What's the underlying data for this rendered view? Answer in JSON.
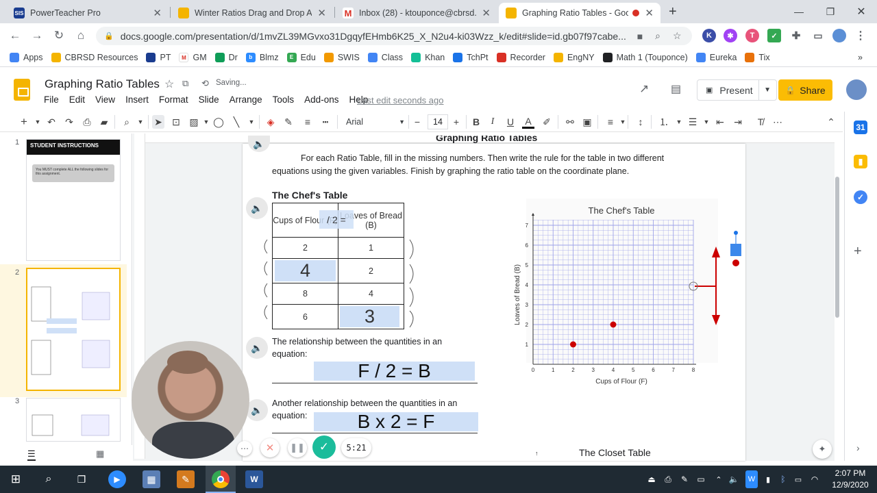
{
  "tabs": [
    {
      "title": "PowerTeacher Pro",
      "icon": "sis-icon"
    },
    {
      "title": "Winter Ratios Drag and Drop Act",
      "icon": "slides-icon"
    },
    {
      "title": "Inbox (28) - ktouponce@cbrsd.o",
      "icon": "gmail-icon"
    },
    {
      "title": "Graphing Ratio Tables - Goo",
      "icon": "slides-icon",
      "active": true
    }
  ],
  "url": "docs.google.com/presentation/d/1mvZL39MGvxo31DgqyfEHmb6K25_X_N2u4-ki03Wzz_k/edit#slide=id.gb07f97cabe...",
  "bookmarks": [
    "Apps",
    "CBRSD Resources",
    "PT",
    "GM",
    "Dr",
    "Blmz",
    "Edu",
    "SWIS",
    "Class",
    "Khan",
    "TchPt",
    "Recorder",
    "EngNY",
    "Math 1 (Touponce)",
    "Eureka",
    "Tix"
  ],
  "doc": {
    "title": "Graphing Ratio Tables",
    "saving": "Saving...",
    "last_edit": "Last edit seconds ago"
  },
  "menu": [
    "File",
    "Edit",
    "View",
    "Insert",
    "Format",
    "Slide",
    "Arrange",
    "Tools",
    "Add-ons",
    "Help"
  ],
  "buttons": {
    "present": "Present",
    "share": "Share"
  },
  "toolbar": {
    "font": "Arial",
    "font_size": "14"
  },
  "filmstrip": {
    "numbers": [
      "1",
      "2",
      "3"
    ],
    "thumb1_title": "STUDENT INSTRUCTIONS",
    "thumb1_text": "You MUST complete ALL the following slides for this assignment."
  },
  "slide": {
    "heading": "Graphing Ratio Tables",
    "instructions": "For each Ratio Table, fill in the missing numbers.  Then write the rule for the table in two different equations using the given variables.  Finish by graphing the ratio table on the coordinate plane.",
    "table_title": "The Chef's Table",
    "col1": "Cups of Flour (F)",
    "col2": "Loaves of Bread (B)",
    "rule_label": "/ 2 =",
    "rows": [
      [
        "2",
        "1"
      ],
      [
        "4",
        "2"
      ],
      [
        "8",
        "4"
      ],
      [
        "6",
        "3"
      ]
    ],
    "rel1": "The relationship between the quantities in an equation:",
    "eq1": "F / 2 = B",
    "rel2": "Another relationship between the quantities in an equation:",
    "eq2": "B x 2 = F",
    "closet": "The Closet Table"
  },
  "chart_data": {
    "type": "scatter",
    "title": "The Chef's Table",
    "xlabel": "Cups of Flour (F)",
    "ylabel": "Loaves of Bread (B)",
    "xlim": [
      0,
      8
    ],
    "ylim": [
      0,
      7
    ],
    "xticks": [
      "0",
      "1",
      "2",
      "3",
      "4",
      "5",
      "6",
      "7",
      "8"
    ],
    "yticks": [
      "1",
      "2",
      "3",
      "4",
      "5",
      "6",
      "7"
    ],
    "points": [
      {
        "x": 2,
        "y": 1
      },
      {
        "x": 4,
        "y": 2
      }
    ],
    "grid": true,
    "point_color": "#cc0000"
  },
  "recorder": {
    "time": "5:21"
  },
  "clock": {
    "time": "2:07 PM",
    "date": "12/9/2020"
  }
}
